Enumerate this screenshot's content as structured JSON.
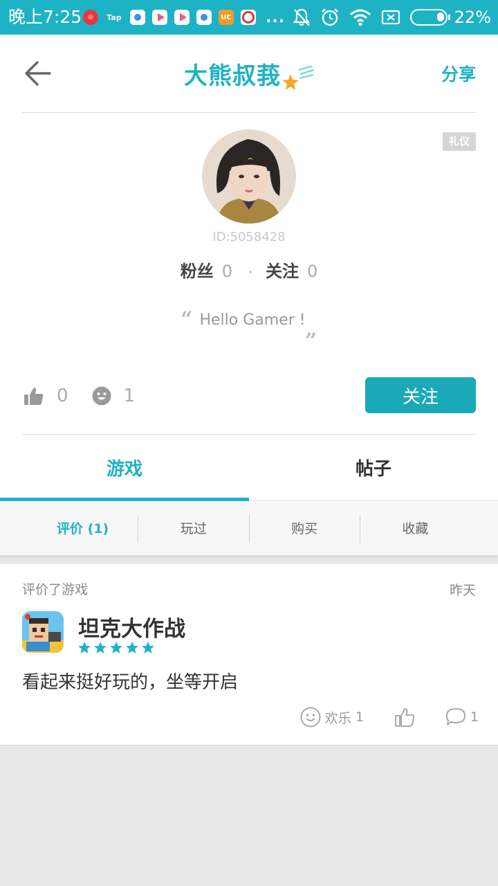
{
  "status_bar": {
    "time": "晚上7:25",
    "tap_label": "Tap",
    "more": "...",
    "battery_percent": "22%",
    "battery_level": 0.22
  },
  "header": {
    "title": "大熊叔莪",
    "share_label": "分享"
  },
  "profile": {
    "badge": "礼仪",
    "user_id": "ID:5058428",
    "fans_label": "粉丝",
    "fans_count": "0",
    "following_label": "关注",
    "following_count": "0",
    "motto": "Hello Gamer !",
    "likes_count": "0",
    "fun_count": "1",
    "follow_button": "关注"
  },
  "tabs": [
    {
      "label": "游戏",
      "active": true
    },
    {
      "label": "帖子",
      "active": false
    }
  ],
  "subtabs": [
    {
      "label": "评价 (1)",
      "active": true
    },
    {
      "label": "玩过",
      "active": false
    },
    {
      "label": "购买",
      "active": false
    },
    {
      "label": "收藏",
      "active": false
    }
  ],
  "review": {
    "header": "评价了游戏",
    "time": "昨天",
    "game_name": "坦克大作战",
    "rating": 5,
    "text": "看起来挺好玩的，坐等开启",
    "fun_label": "欢乐",
    "fun_count": "1",
    "comment_count": "1"
  },
  "colors": {
    "accent": "#1eb3c4",
    "button": "#1ba9b8",
    "background": "#e8e8e8"
  }
}
